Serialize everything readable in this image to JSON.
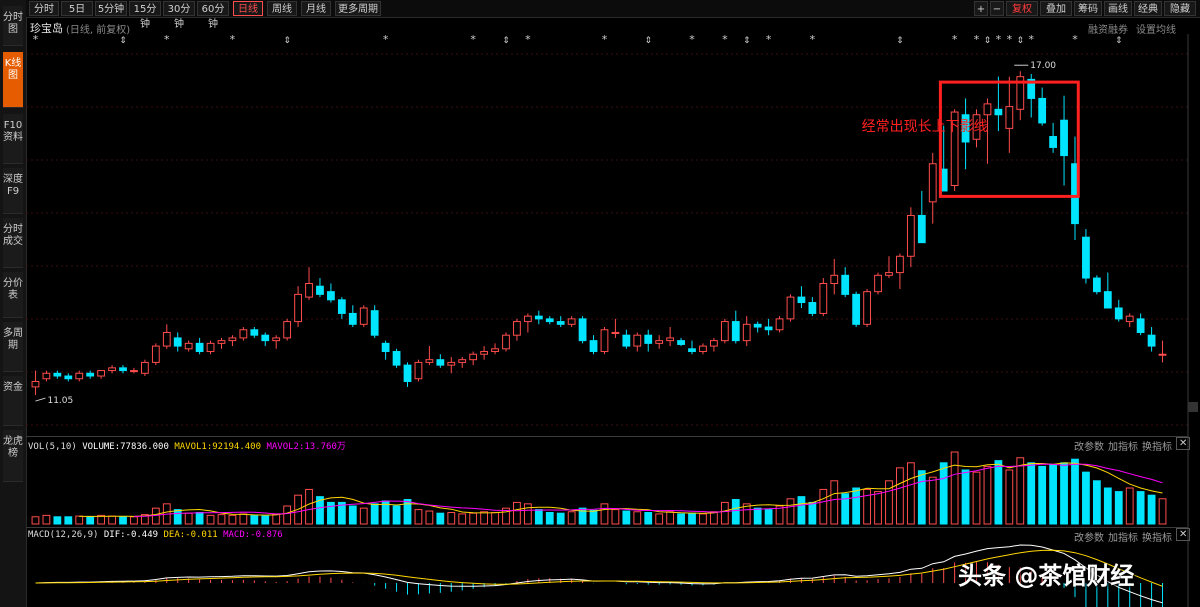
{
  "sidebar": {
    "items": [
      {
        "label": "分时图"
      },
      {
        "label": "K线图"
      },
      {
        "label": "F10资料"
      },
      {
        "label": "深度F9"
      },
      {
        "label": "分时成交"
      },
      {
        "label": "分价表"
      },
      {
        "label": "多周期"
      },
      {
        "label": "资金"
      },
      {
        "label": "龙虎榜"
      }
    ]
  },
  "toolbar": {
    "periods": [
      "分时",
      "5日",
      "5分钟",
      "15分钟",
      "30分钟",
      "60分钟",
      "日线",
      "周线",
      "月线",
      "更多周期"
    ],
    "active_period": "日线",
    "right": [
      "+",
      "−",
      "复权",
      "叠加",
      "筹码",
      "画线",
      "经典",
      "隐藏"
    ]
  },
  "header": {
    "stock_name": "珍宝岛",
    "subtitle": "(日线, 前复权)",
    "margin_label": "融资融券",
    "settings_label": "设置均线"
  },
  "annotation": {
    "text": "经常出现长上下影线",
    "high_label": "17.00",
    "low_label": "11.05"
  },
  "vol_panel": {
    "title": "VOL(5,10)",
    "volume": "VOLUME:77836.000",
    "mavol1": "MAVOL1:92194.400",
    "mavol2": "MAVOL2:13.760万",
    "change_params": "改参数",
    "add_indicator": "加指标",
    "switch_indicator": "换指标"
  },
  "macd_panel": {
    "title": "MACD(12,26,9)",
    "dif": "DIF:-0.449",
    "dea": "DEA:-0.011",
    "macd": "MACD:-0.876",
    "change_params": "改参数",
    "add_indicator": "加指标",
    "switch_indicator": "换指标"
  },
  "watermark": "头条 @茶馆财经",
  "colors": {
    "up": "#ff4d4d",
    "down": "#00e5ff",
    "ma_white": "#ffffff",
    "ma_yellow": "#ffd700",
    "ma_magenta": "#ff00ff",
    "annotation": "#ff2020"
  },
  "chart_data": {
    "type": "candlestick",
    "title": "珍宝岛",
    "y_range": [
      10.5,
      17.5
    ],
    "candles": [
      [
        11.2,
        11.5,
        11.05,
        11.3
      ],
      [
        11.35,
        11.5,
        11.3,
        11.45
      ],
      [
        11.45,
        11.5,
        11.35,
        11.4
      ],
      [
        11.4,
        11.45,
        11.3,
        11.35
      ],
      [
        11.35,
        11.5,
        11.3,
        11.45
      ],
      [
        11.45,
        11.5,
        11.35,
        11.4
      ],
      [
        11.4,
        11.5,
        11.35,
        11.5
      ],
      [
        11.5,
        11.6,
        11.45,
        11.55
      ],
      [
        11.55,
        11.6,
        11.45,
        11.5
      ],
      [
        11.5,
        11.55,
        11.45,
        11.5
      ],
      [
        11.45,
        11.7,
        11.4,
        11.65
      ],
      [
        11.65,
        12.0,
        11.6,
        11.95
      ],
      [
        11.95,
        12.35,
        11.9,
        12.2
      ],
      [
        12.1,
        12.2,
        11.85,
        11.95
      ],
      [
        11.9,
        12.05,
        11.85,
        12.0
      ],
      [
        12.0,
        12.1,
        11.8,
        11.85
      ],
      [
        11.85,
        12.05,
        11.8,
        12.0
      ],
      [
        12.0,
        12.1,
        11.9,
        12.05
      ],
      [
        12.05,
        12.15,
        11.95,
        12.1
      ],
      [
        12.1,
        12.3,
        12.05,
        12.25
      ],
      [
        12.25,
        12.3,
        12.1,
        12.15
      ],
      [
        12.15,
        12.2,
        11.95,
        12.05
      ],
      [
        12.05,
        12.15,
        11.9,
        12.1
      ],
      [
        12.1,
        12.45,
        12.05,
        12.4
      ],
      [
        12.4,
        13.05,
        12.3,
        12.9
      ],
      [
        12.85,
        13.4,
        12.8,
        13.1
      ],
      [
        13.05,
        13.2,
        12.85,
        12.9
      ],
      [
        12.95,
        13.1,
        12.75,
        12.8
      ],
      [
        12.8,
        12.85,
        12.45,
        12.55
      ],
      [
        12.55,
        12.7,
        12.3,
        12.35
      ],
      [
        12.35,
        12.7,
        12.3,
        12.65
      ],
      [
        12.6,
        12.7,
        12.1,
        12.15
      ],
      [
        12.0,
        12.05,
        11.7,
        11.85
      ],
      [
        11.85,
        11.9,
        11.55,
        11.6
      ],
      [
        11.6,
        11.65,
        11.2,
        11.3
      ],
      [
        11.35,
        11.7,
        11.3,
        11.65
      ],
      [
        11.65,
        11.95,
        11.6,
        11.7
      ],
      [
        11.7,
        11.8,
        11.55,
        11.6
      ],
      [
        11.6,
        11.75,
        11.45,
        11.65
      ],
      [
        11.65,
        11.75,
        11.55,
        11.7
      ],
      [
        11.7,
        11.85,
        11.6,
        11.8
      ],
      [
        11.8,
        11.95,
        11.7,
        11.85
      ],
      [
        11.85,
        12.0,
        11.8,
        11.9
      ],
      [
        11.9,
        12.2,
        11.85,
        12.15
      ],
      [
        12.15,
        12.45,
        12.05,
        12.4
      ],
      [
        12.4,
        12.55,
        12.2,
        12.5
      ],
      [
        12.5,
        12.6,
        12.35,
        12.45
      ],
      [
        12.45,
        12.5,
        12.35,
        12.4
      ],
      [
        12.4,
        12.5,
        12.3,
        12.35
      ],
      [
        12.35,
        12.5,
        12.3,
        12.45
      ],
      [
        12.45,
        12.5,
        12.0,
        12.05
      ],
      [
        12.05,
        12.15,
        11.8,
        11.85
      ],
      [
        11.85,
        12.3,
        11.8,
        12.25
      ],
      [
        12.2,
        12.45,
        12.1,
        12.2
      ],
      [
        12.15,
        12.25,
        11.9,
        11.95
      ],
      [
        11.95,
        12.2,
        11.85,
        12.15
      ],
      [
        12.15,
        12.25,
        11.85,
        12.0
      ],
      [
        12.0,
        12.15,
        11.9,
        12.05
      ],
      [
        12.05,
        12.3,
        11.95,
        12.1
      ],
      [
        12.05,
        12.1,
        11.95,
        11.98
      ],
      [
        11.9,
        12.05,
        11.8,
        11.85
      ],
      [
        11.85,
        12.0,
        11.8,
        11.95
      ],
      [
        11.95,
        12.1,
        11.85,
        12.05
      ],
      [
        12.05,
        12.45,
        12.0,
        12.4
      ],
      [
        12.4,
        12.6,
        12.0,
        12.05
      ],
      [
        12.05,
        12.5,
        11.95,
        12.35
      ],
      [
        12.35,
        12.4,
        12.2,
        12.3
      ],
      [
        12.3,
        12.45,
        12.15,
        12.25
      ],
      [
        12.25,
        12.5,
        12.2,
        12.45
      ],
      [
        12.45,
        12.9,
        12.4,
        12.85
      ],
      [
        12.85,
        13.05,
        12.65,
        12.75
      ],
      [
        12.75,
        12.85,
        12.5,
        12.55
      ],
      [
        12.55,
        13.2,
        12.5,
        13.1
      ],
      [
        13.1,
        13.55,
        12.9,
        13.25
      ],
      [
        13.25,
        13.4,
        12.85,
        12.9
      ],
      [
        12.9,
        12.95,
        12.3,
        12.35
      ],
      [
        12.35,
        13.0,
        12.3,
        12.95
      ],
      [
        12.95,
        13.3,
        12.9,
        13.25
      ],
      [
        13.25,
        13.6,
        13.2,
        13.3
      ],
      [
        13.3,
        13.65,
        13.0,
        13.6
      ],
      [
        13.6,
        14.5,
        13.4,
        14.35
      ],
      [
        14.35,
        14.8,
        13.85,
        13.85
      ],
      [
        14.6,
        15.5,
        14.2,
        15.3
      ],
      [
        15.2,
        16.0,
        14.8,
        14.8
      ],
      [
        14.9,
        16.3,
        14.8,
        16.25
      ],
      [
        16.2,
        16.5,
        15.2,
        15.7
      ],
      [
        15.75,
        16.3,
        15.6,
        16.2
      ],
      [
        16.2,
        16.5,
        15.3,
        16.4
      ],
      [
        16.3,
        16.9,
        15.9,
        16.2
      ],
      [
        15.95,
        16.9,
        15.5,
        16.35
      ],
      [
        16.3,
        17.0,
        16.1,
        16.9
      ],
      [
        16.85,
        16.95,
        16.15,
        16.5
      ],
      [
        16.5,
        16.7,
        16.0,
        16.05
      ],
      [
        15.8,
        16.05,
        15.5,
        15.6
      ],
      [
        16.1,
        16.55,
        14.9,
        15.45
      ],
      [
        15.3,
        15.8,
        13.9,
        14.2
      ],
      [
        13.95,
        14.1,
        13.1,
        13.2
      ],
      [
        13.2,
        13.25,
        12.9,
        12.95
      ],
      [
        12.95,
        13.3,
        12.7,
        12.65
      ],
      [
        12.65,
        12.8,
        12.4,
        12.45
      ],
      [
        12.4,
        12.55,
        12.3,
        12.5
      ],
      [
        12.45,
        12.55,
        12.15,
        12.2
      ],
      [
        12.15,
        12.3,
        11.85,
        11.95
      ],
      [
        11.8,
        12.05,
        11.65,
        11.8
      ]
    ],
    "volume": [
      0.1,
      0.12,
      0.1,
      0.1,
      0.11,
      0.1,
      0.12,
      0.11,
      0.1,
      0.1,
      0.13,
      0.22,
      0.28,
      0.2,
      0.15,
      0.16,
      0.12,
      0.13,
      0.12,
      0.14,
      0.12,
      0.11,
      0.14,
      0.25,
      0.4,
      0.48,
      0.38,
      0.3,
      0.3,
      0.25,
      0.22,
      0.28,
      0.32,
      0.25,
      0.34,
      0.2,
      0.18,
      0.15,
      0.16,
      0.14,
      0.15,
      0.17,
      0.16,
      0.22,
      0.3,
      0.28,
      0.2,
      0.16,
      0.15,
      0.17,
      0.22,
      0.19,
      0.28,
      0.2,
      0.18,
      0.17,
      0.16,
      0.14,
      0.17,
      0.14,
      0.15,
      0.14,
      0.17,
      0.3,
      0.34,
      0.28,
      0.22,
      0.2,
      0.25,
      0.35,
      0.38,
      0.3,
      0.48,
      0.6,
      0.42,
      0.5,
      0.48,
      0.45,
      0.6,
      0.78,
      0.85,
      0.74,
      0.65,
      0.85,
      1.0,
      0.75,
      0.72,
      0.8,
      0.88,
      0.75,
      0.92,
      0.85,
      0.8,
      0.82,
      0.85,
      0.9,
      0.72,
      0.6,
      0.5,
      0.45,
      0.5,
      0.45,
      0.4,
      0.35
    ],
    "macd_dif_note": "DIF/DEA lines and MACD histogram"
  }
}
